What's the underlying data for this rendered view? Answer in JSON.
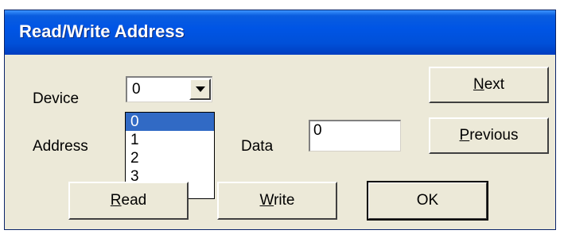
{
  "window": {
    "title": "Read/Write Address"
  },
  "labels": {
    "device": "Device",
    "address": "Address",
    "data": "Data"
  },
  "device_combo": {
    "value": "0",
    "options": [
      "0",
      "1",
      "2",
      "3"
    ],
    "selected_index": 0
  },
  "address_field": {
    "value": ""
  },
  "data_field": {
    "value": "0"
  },
  "buttons": {
    "next": {
      "accel": "N",
      "rest": "ext"
    },
    "previous": {
      "accel": "P",
      "rest": "revious"
    },
    "read": {
      "accel": "R",
      "rest": "ead"
    },
    "write": {
      "accel": "W",
      "rest": "rite"
    },
    "ok": {
      "label": "OK"
    }
  },
  "icons": {
    "dropdown_arrow": "chevron-down-icon"
  }
}
